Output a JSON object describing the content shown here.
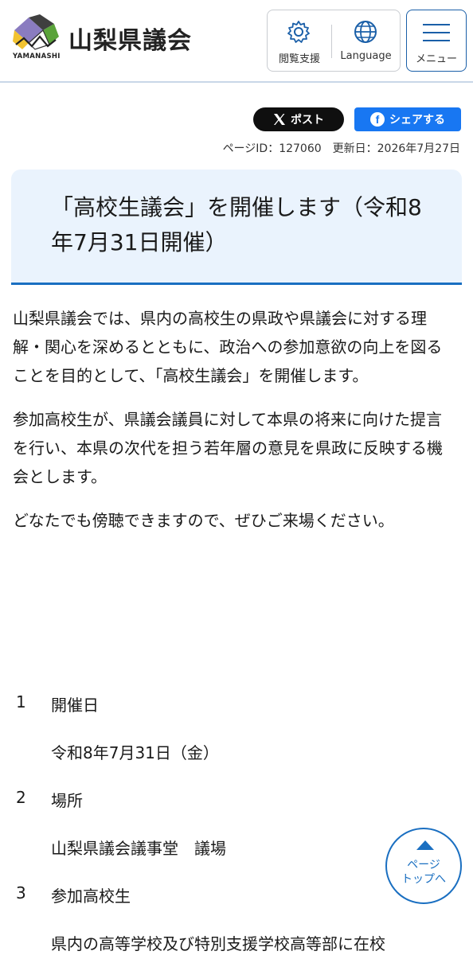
{
  "header": {
    "logo_title": "山梨県議会",
    "logo_sub": "YAMANASHI",
    "accessibility_label": "閲覧支援",
    "language_label": "Language",
    "menu_label": "メニュー"
  },
  "share": {
    "x_label": "ポスト",
    "fb_label": "シェアする"
  },
  "meta": {
    "page_id": "ページID：127060",
    "updated": "更新日：2026年7月27日"
  },
  "title": "「高校生議会」を開催します（令和8年7月31日開催）",
  "paragraphs": [
    "山梨県議会では、県内の高校生の県政や県議会に対する理解・関心を深めるとともに、政治への参加意欲の向上を図ることを目的として、「高校生議会」を開催します。",
    "参加高校生が、県議会議員に対して本県の将来に向けた提言を行い、本県の次代を担う若年層の意見を県政に反映する機会とします。",
    "どなたでも傍聴できますので、ぜひご来場ください。"
  ],
  "items": [
    {
      "num": "1",
      "heading": "開催日",
      "value": "令和8年7月31日（金）"
    },
    {
      "num": "2",
      "heading": "場所",
      "value": "山梨県議会議事堂　議場"
    },
    {
      "num": "3",
      "heading": "参加高校生",
      "value": "県内の高等学校及び特別支援学校高等部に在校"
    }
  ],
  "pagetop": {
    "line1": "ページ",
    "line2": "トップへ"
  },
  "colors": {
    "accent": "#1a6fc1",
    "title_bg": "#eaf3fd",
    "x_button": "#0f0f0f",
    "facebook": "#1877f2"
  }
}
